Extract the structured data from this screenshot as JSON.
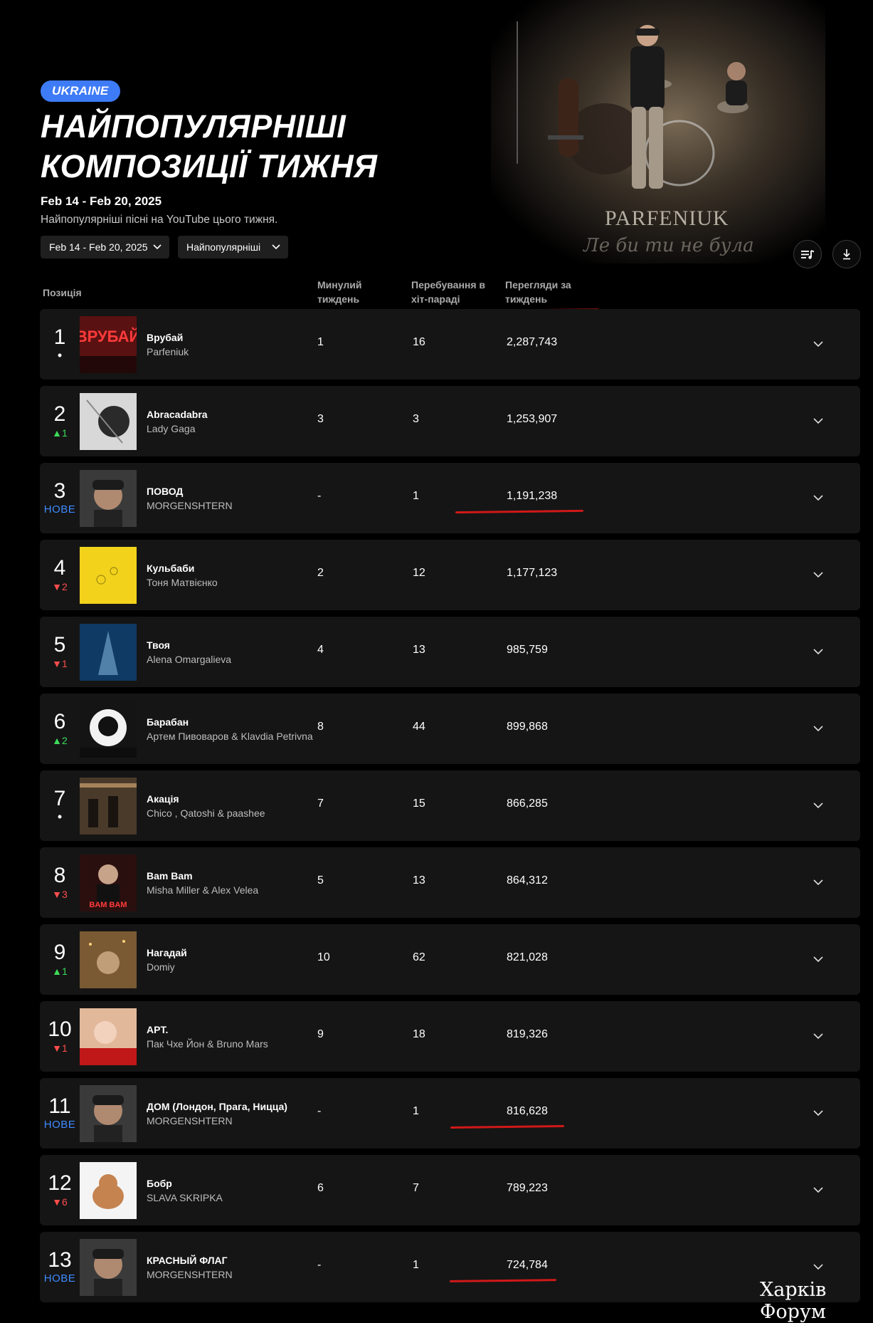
{
  "header": {
    "country_badge": "UKRAINE",
    "title": "НАЙПОПУЛЯРНІШІ КОМПОЗИЦІЇ ТИЖНЯ",
    "date_range": "Feb 14 - Feb 20, 2025",
    "subtitle": "Найпопулярніші пісні на YouTube цього тижня.",
    "hero_brand": "PARFENIUK",
    "hero_script": "Ле би ти не була"
  },
  "filters": {
    "period": "Feb 14 - Feb 20, 2025",
    "chart_type": "Найпопулярніші"
  },
  "columns": {
    "position": "Позиція",
    "last_week": "Минулий тиждень",
    "weeks_on_chart": "Перебування в хіт-параді",
    "weekly_views": "Перегляди за тиждень"
  },
  "rows": [
    {
      "rank": "1",
      "change": "•",
      "change_type": "same",
      "title": "Врубай",
      "artist": "Parfeniuk",
      "last_week": "1",
      "weeks": "16",
      "views": "2,287,743",
      "thumb": "#5a1111"
    },
    {
      "rank": "2",
      "change": "▲1",
      "change_type": "up",
      "title": "Abracadabra",
      "artist": "Lady Gaga",
      "last_week": "3",
      "weeks": "3",
      "views": "1,253,907",
      "thumb": "#d8d8d8"
    },
    {
      "rank": "3",
      "change": "НОВЕ",
      "change_type": "new",
      "title": "ПОВОД",
      "artist": "MORGENSHTERN",
      "last_week": "-",
      "weeks": "1",
      "views": "1,191,238",
      "thumb": "#3a3a3a"
    },
    {
      "rank": "4",
      "change": "▼2",
      "change_type": "down",
      "title": "Кульбаби",
      "artist": "Тоня Матвієнко",
      "last_week": "2",
      "weeks": "12",
      "views": "1,177,123",
      "thumb": "#f2d21b"
    },
    {
      "rank": "5",
      "change": "▼1",
      "change_type": "down",
      "title": "Твоя",
      "artist": "Alena Omargalieva",
      "last_week": "4",
      "weeks": "13",
      "views": "985,759",
      "thumb": "#0e3a63"
    },
    {
      "rank": "6",
      "change": "▲2",
      "change_type": "up",
      "title": "Барабан",
      "artist": "Артем Пивоваров & Klavdia Petrivna",
      "last_week": "8",
      "weeks": "44",
      "views": "899,868",
      "thumb": "#141414"
    },
    {
      "rank": "7",
      "change": "•",
      "change_type": "same",
      "title": "Акація",
      "artist": "Chico , Qatoshi & paashee",
      "last_week": "7",
      "weeks": "15",
      "views": "866,285",
      "thumb": "#4a3a2a"
    },
    {
      "rank": "8",
      "change": "▼3",
      "change_type": "down",
      "title": "Bam Bam",
      "artist": "Misha Miller & Alex Velea",
      "last_week": "5",
      "weeks": "13",
      "views": "864,312",
      "thumb": "#2a0f0f"
    },
    {
      "rank": "9",
      "change": "▲1",
      "change_type": "up",
      "title": "Нагадай",
      "artist": "Domiy",
      "last_week": "10",
      "weeks": "62",
      "views": "821,028",
      "thumb": "#7a5a33"
    },
    {
      "rank": "10",
      "change": "▼1",
      "change_type": "down",
      "title": "APT.",
      "artist": "Пак Чхе Йон & Bruno Mars",
      "last_week": "9",
      "weeks": "18",
      "views": "819,326",
      "thumb": "#e2b89a"
    },
    {
      "rank": "11",
      "change": "НОВЕ",
      "change_type": "new",
      "title": "ДОМ (Лондон, Прага, Ницца)",
      "artist": "MORGENSHTERN",
      "last_week": "-",
      "weeks": "1",
      "views": "816,628",
      "thumb": "#3a3a3a"
    },
    {
      "rank": "12",
      "change": "▼6",
      "change_type": "down",
      "title": "Бобр",
      "artist": "SLAVA SKRIPKA",
      "last_week": "6",
      "weeks": "7",
      "views": "789,223",
      "thumb": "#f4f4f4"
    },
    {
      "rank": "13",
      "change": "НОВЕ",
      "change_type": "new",
      "title": "КРАСНЫЙ ФЛАГ",
      "artist": "MORGENSHTERN",
      "last_week": "-",
      "weeks": "1",
      "views": "724,784",
      "thumb": "#3a3a3a"
    }
  ],
  "thumb_texts": {
    "row1": "ВРУБАЙ",
    "row8": "BAM BAM"
  },
  "accent_colors": {
    "badge": "#3e7bf7",
    "up": "#3ddc5a",
    "down": "#ff4d4d",
    "new": "#3e8bff",
    "annotation": "#d01818"
  },
  "watermark": "Харків Форум"
}
